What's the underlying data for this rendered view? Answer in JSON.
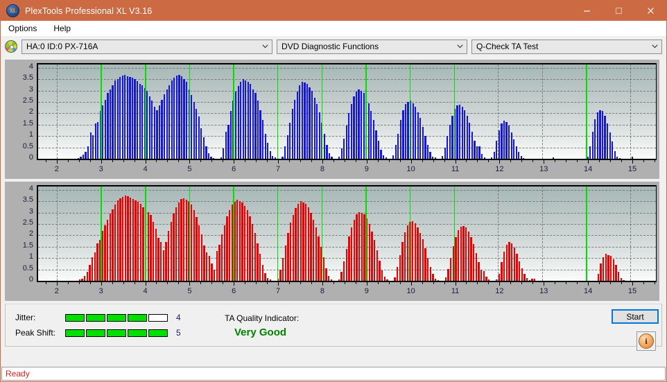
{
  "window": {
    "title": "PlexTools Professional XL V3.16",
    "app_icon": "xl-disc-icon",
    "minimize_label": "Minimize",
    "maximize_label": "Maximize",
    "close_label": "Close"
  },
  "menubar": {
    "items": [
      {
        "label": "Options",
        "name": "menu-options"
      },
      {
        "label": "Help",
        "name": "menu-help"
      }
    ]
  },
  "toolbar": {
    "drive_icon": "optical-disc-icon",
    "drive_select": {
      "value": "HA:0 ID:0  PX-716A"
    },
    "function_select": {
      "value": "DVD Diagnostic Functions"
    },
    "test_select": {
      "value": "Q-Check TA Test"
    }
  },
  "chart_data": [
    {
      "type": "bar",
      "name": "ta-test-jitter-chart",
      "title": "",
      "xlabel": "",
      "ylabel": "",
      "color": "#1515e0",
      "xlim": [
        1.58,
        15.58
      ],
      "ylim": [
        0,
        4.15
      ],
      "yticks": [
        0,
        0.5,
        1,
        1.5,
        2,
        2.5,
        3,
        3.5,
        4
      ],
      "ytick_labels": [
        "0",
        "0.5",
        "1",
        "1.5",
        "2",
        "2.5",
        "3",
        "3.5",
        "4"
      ],
      "xticks": [
        2,
        3,
        4,
        5,
        6,
        7,
        8,
        9,
        10,
        11,
        12,
        13,
        14,
        15
      ],
      "xtick_labels": [
        "2",
        "3",
        "4",
        "5",
        "6",
        "7",
        "8",
        "9",
        "10",
        "11",
        "12",
        "13",
        "14",
        "15"
      ],
      "grid": true,
      "markers": [
        3,
        4,
        5,
        6,
        7,
        8,
        9,
        10,
        11,
        14
      ],
      "values": [
        0,
        0,
        0,
        0,
        0,
        0,
        0,
        0,
        0,
        0,
        0,
        0,
        0,
        0,
        0,
        0,
        0.04,
        0.1,
        0.18,
        0.3,
        0.55,
        1.15,
        1.05,
        1.55,
        1.62,
        2.1,
        2.35,
        2.6,
        2.9,
        3.05,
        3.25,
        3.45,
        3.5,
        3.6,
        3.65,
        3.68,
        3.62,
        3.6,
        3.58,
        3.5,
        3.42,
        3.3,
        3.22,
        3.1,
        3.0,
        2.75,
        2.55,
        2.3,
        2.15,
        2.35,
        2.6,
        2.85,
        3.05,
        3.25,
        3.45,
        3.58,
        3.65,
        3.68,
        3.62,
        3.5,
        3.4,
        3.05,
        2.8,
        2.5,
        2.2,
        1.85,
        1.35,
        0.95,
        0.55,
        0.25,
        0.1,
        0.04,
        0,
        0,
        0.05,
        0.45,
        1.2,
        1.5,
        2.1,
        2.55,
        2.95,
        3.2,
        3.4,
        3.5,
        3.45,
        3.38,
        3.3,
        3.05,
        2.9,
        2.55,
        2.15,
        1.7,
        1.1,
        0.7,
        0.35,
        0.12,
        0.05,
        0,
        0,
        0.1,
        0.55,
        1.05,
        1.6,
        2.2,
        2.6,
        2.95,
        3.25,
        3.4,
        3.35,
        3.3,
        3.15,
        3.0,
        2.7,
        2.4,
        2.05,
        1.6,
        1.1,
        0.6,
        0.25,
        0.08,
        0,
        0,
        0.08,
        0.45,
        0.9,
        1.45,
        2.0,
        2.4,
        2.75,
        2.95,
        3.05,
        3.0,
        2.9,
        2.7,
        2.45,
        2.1,
        1.7,
        1.25,
        0.8,
        0.4,
        0.15,
        0.05,
        0,
        0,
        0.15,
        0.6,
        1.1,
        1.7,
        2.15,
        2.4,
        2.5,
        2.55,
        2.45,
        2.3,
        2.05,
        1.8,
        1.4,
        1.0,
        0.6,
        0.3,
        0.1,
        0.05,
        0,
        0,
        0.12,
        0.5,
        1.0,
        1.5,
        1.9,
        2.2,
        2.35,
        2.38,
        2.3,
        2.15,
        1.9,
        1.6,
        1.2,
        0.8,
        0.55,
        0.55,
        0.2,
        0.05,
        0,
        0,
        0.05,
        0.3,
        0.8,
        1.25,
        1.55,
        1.68,
        1.62,
        1.45,
        1.15,
        0.85,
        0.55,
        0.3,
        0.12,
        0.04,
        0,
        0,
        0,
        0,
        0,
        0,
        0,
        0,
        0,
        0,
        0,
        0.05,
        0,
        0,
        0,
        0,
        0,
        0,
        0,
        0,
        0,
        0,
        0,
        0,
        0,
        0.1,
        0.55,
        1.2,
        1.75,
        2.05,
        2.15,
        2.1,
        1.9,
        1.55,
        1.15,
        0.75,
        0.35,
        0.1,
        0.03,
        0,
        0,
        0,
        0,
        0.1,
        0,
        0,
        0,
        0,
        0,
        0,
        0,
        0,
        0
      ]
    },
    {
      "type": "bar",
      "name": "ta-test-peak-shift-chart",
      "title": "",
      "xlabel": "",
      "ylabel": "",
      "color": "#ee0000",
      "xlim": [
        1.58,
        15.58
      ],
      "ylim": [
        0,
        4.15
      ],
      "yticks": [
        0,
        0.5,
        1,
        1.5,
        2,
        2.5,
        3,
        3.5,
        4
      ],
      "ytick_labels": [
        "0",
        "0.5",
        "1",
        "1.5",
        "2",
        "2.5",
        "3",
        "3.5",
        "4"
      ],
      "xticks": [
        2,
        3,
        4,
        5,
        6,
        7,
        8,
        9,
        10,
        11,
        12,
        13,
        14,
        15
      ],
      "xtick_labels": [
        "2",
        "3",
        "4",
        "5",
        "6",
        "7",
        "8",
        "9",
        "10",
        "11",
        "12",
        "13",
        "14",
        "15"
      ],
      "grid": true,
      "markers": [
        3,
        4,
        5,
        6,
        7,
        8,
        9,
        10,
        11,
        14
      ],
      "values": [
        0,
        0,
        0,
        0,
        0,
        0,
        0,
        0,
        0,
        0,
        0,
        0,
        0,
        0,
        0,
        0,
        0.05,
        0.1,
        0.2,
        0.4,
        0.7,
        1.05,
        1.25,
        1.65,
        1.8,
        2.2,
        2.45,
        2.7,
        2.95,
        3.15,
        3.35,
        3.55,
        3.62,
        3.7,
        3.74,
        3.72,
        3.66,
        3.6,
        3.55,
        3.48,
        3.38,
        3.25,
        3.15,
        3.02,
        2.9,
        2.6,
        2.3,
        1.9,
        1.7,
        1.35,
        1.7,
        2.2,
        2.6,
        2.95,
        3.25,
        3.45,
        3.6,
        3.64,
        3.58,
        3.48,
        3.35,
        3.1,
        2.8,
        2.45,
        2.05,
        1.55,
        1.25,
        1.1,
        0.75,
        0.5,
        1.3,
        1.6,
        2.05,
        2.45,
        2.85,
        3.1,
        3.35,
        3.48,
        3.56,
        3.52,
        3.44,
        3.3,
        3.1,
        2.85,
        2.5,
        2.1,
        1.65,
        1.2,
        0.7,
        0.35,
        0.12,
        0.05,
        0,
        0,
        0.1,
        0.5,
        1.0,
        1.55,
        2.1,
        2.55,
        2.9,
        3.2,
        3.4,
        3.52,
        3.46,
        3.38,
        3.22,
        3.0,
        2.7,
        2.35,
        1.95,
        1.5,
        1.05,
        0.55,
        0.22,
        0.07,
        0,
        0,
        0.07,
        0.4,
        0.85,
        1.4,
        1.95,
        2.35,
        2.7,
        2.92,
        3.02,
        3.0,
        2.92,
        2.76,
        2.5,
        2.18,
        1.8,
        1.35,
        0.9,
        0.45,
        0.18,
        0.05,
        0,
        0,
        0.16,
        0.62,
        1.12,
        1.7,
        2.15,
        2.45,
        2.58,
        2.62,
        2.52,
        2.36,
        2.12,
        1.82,
        1.42,
        1.02,
        0.62,
        0.3,
        0.1,
        0.04,
        0,
        0,
        0.14,
        0.52,
        1.02,
        1.52,
        1.92,
        2.22,
        2.38,
        2.42,
        2.34,
        2.18,
        1.92,
        1.62,
        1.22,
        0.82,
        0.5,
        0.42,
        0.18,
        0.05,
        0,
        0,
        0.06,
        0.32,
        0.82,
        1.28,
        1.58,
        1.72,
        1.66,
        1.48,
        1.18,
        0.86,
        0.56,
        0.3,
        0.12,
        0.04,
        0.08,
        0.08,
        0,
        0,
        0,
        0,
        0,
        0,
        0,
        0,
        0,
        0,
        0,
        0,
        0,
        0,
        0,
        0,
        0,
        0,
        0,
        0,
        0,
        0,
        0,
        0,
        0.3,
        0.75,
        1.05,
        1.18,
        1.12,
        1.1,
        0.95,
        0.7,
        0.4,
        0.12,
        0.03,
        0,
        0,
        0,
        0,
        0,
        0,
        0,
        0,
        0,
        0,
        0,
        0
      ]
    }
  ],
  "metrics": {
    "jitter": {
      "label": "Jitter:",
      "filled": 4,
      "total": 5,
      "value": "4"
    },
    "peak_shift": {
      "label": "Peak Shift:",
      "filled": 5,
      "total": 5,
      "value": "5"
    },
    "quality": {
      "label": "TA Quality Indicator:",
      "value": "Very Good",
      "color": "#008000"
    }
  },
  "actions": {
    "start_label": "Start",
    "info_icon": "info-icon"
  },
  "statusbar": {
    "text": "Ready"
  }
}
